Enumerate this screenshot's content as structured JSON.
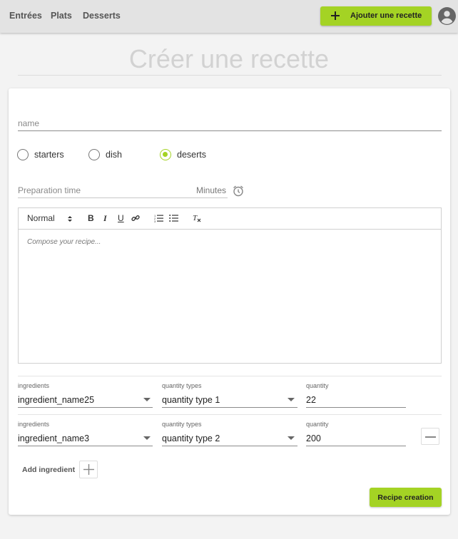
{
  "nav": {
    "items": [
      "Entrées",
      "Plats",
      "Desserts"
    ]
  },
  "header": {
    "add_recipe_label": "Ajouter une recette"
  },
  "page": {
    "title": "Créer une recette"
  },
  "form": {
    "name_label": "name",
    "categories": [
      {
        "label": "starters",
        "selected": false
      },
      {
        "label": "dish",
        "selected": false
      },
      {
        "label": "deserts",
        "selected": true
      }
    ],
    "prep_time_label": "Preparation time",
    "prep_time_unit": "Minutes",
    "editor": {
      "format": "Normal",
      "placeholder": "Compose your recipe..."
    },
    "ingredients": [
      {
        "ingredient_label": "ingredients",
        "ingredient": "ingredient_name25",
        "type_label": "quantity types",
        "type": "quantity type 1",
        "quantity_label": "quantity",
        "quantity": "22"
      },
      {
        "ingredient_label": "ingredients",
        "ingredient": "ingredient_name3",
        "type_label": "quantity types",
        "type": "quantity type 2",
        "quantity_label": "quantity",
        "quantity": "200"
      }
    ],
    "add_ingredient_label": "Add ingredient",
    "submit_label": "Recipe creation"
  },
  "colors": {
    "accent": "#a4d324",
    "topbar": "#e3e3e3",
    "background": "#f3f3f3"
  },
  "icons": [
    "plus-icon",
    "account-icon",
    "alarm-clock-icon",
    "bold-icon",
    "italic-icon",
    "underline-icon",
    "link-icon",
    "ordered-list-icon",
    "bullet-list-icon",
    "clear-format-icon",
    "minus-icon"
  ]
}
